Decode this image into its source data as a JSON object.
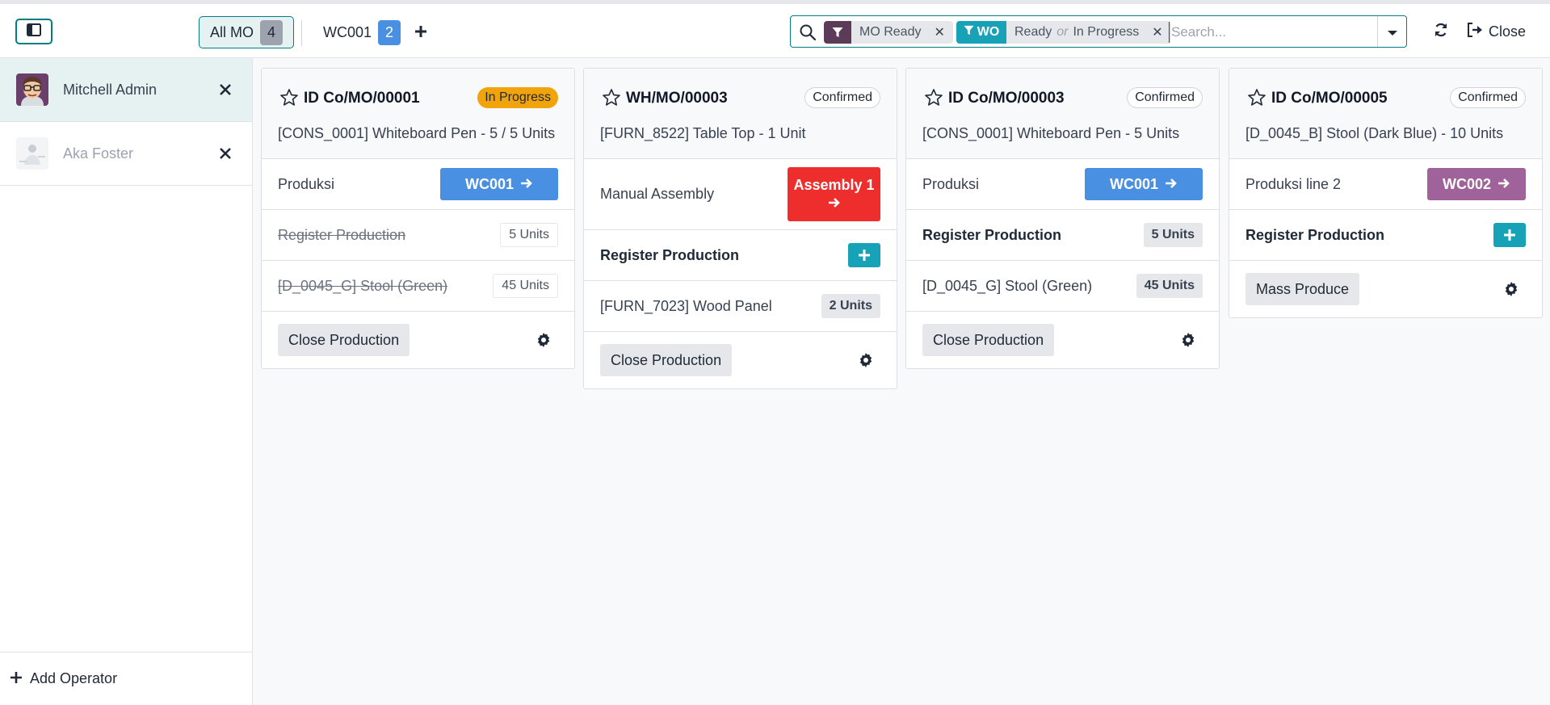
{
  "topbar": {
    "tabs": [
      {
        "label": "All MO",
        "count": "4"
      },
      {
        "label": "WC001",
        "count": "2"
      }
    ],
    "search": {
      "facets": [
        {
          "label": "",
          "values": [
            "MO Ready"
          ],
          "color": "#5b3b58"
        },
        {
          "label": "WO",
          "values": [
            "Ready",
            "In Progress"
          ],
          "joiner": "or",
          "color": "#17a2b8"
        }
      ],
      "placeholder": "Search..."
    },
    "close_label": "Close"
  },
  "operators": [
    {
      "name": "Mitchell Admin",
      "active": true
    },
    {
      "name": "Aka Foster",
      "active": false
    }
  ],
  "add_operator_label": "Add Operator",
  "colors": {
    "accent": "#017e84",
    "wc_blue": "#4a90e2",
    "wc_purple": "#a0629a",
    "alert_red": "#ee2d2d",
    "in_progress": "#f0a30a",
    "plus": "#17a2b8"
  },
  "cards": [
    {
      "title": "ID Co/MO/00001",
      "status": "In Progress",
      "product": "[CONS_0001] Whiteboard Pen - 5 / 5 Units",
      "workcenter": {
        "name": "Produksi",
        "button": "WC001"
      },
      "register": {
        "label": "Register Production",
        "qty": "5 Units"
      },
      "component": {
        "label": "[D_0045_G] Stool (Green)",
        "qty": "45 Units"
      },
      "action": "Close Production"
    },
    {
      "title": "WH/MO/00003",
      "status": "Confirmed",
      "product": "[FURN_8522] Table Top - 1 Unit",
      "workcenter": {
        "name": "Manual Assembly",
        "button": "Assembly 1"
      },
      "register": {
        "label": "Register Production"
      },
      "component": {
        "label": "[FURN_7023] Wood Panel",
        "qty": "2 Units"
      },
      "action": "Close Production"
    },
    {
      "title": "ID Co/MO/00003",
      "status": "Confirmed",
      "product": "[CONS_0001] Whiteboard Pen - 5 Units",
      "workcenter": {
        "name": "Produksi",
        "button": "WC001"
      },
      "register": {
        "label": "Register Production",
        "qty": "5 Units"
      },
      "component": {
        "label": "[D_0045_G] Stool (Green)",
        "qty": "45 Units"
      },
      "action": "Close Production"
    },
    {
      "title": "ID Co/MO/00005",
      "status": "Confirmed",
      "product": "[D_0045_B] Stool (Dark Blue) - 10 Units",
      "workcenter": {
        "name": "Produksi line 2",
        "button": "WC002"
      },
      "register": {
        "label": "Register Production"
      },
      "action": "Mass Produce"
    }
  ]
}
